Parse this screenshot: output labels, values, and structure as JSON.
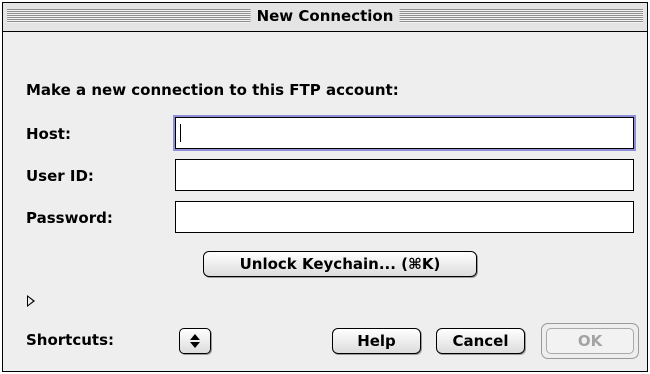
{
  "window": {
    "title": "New Connection"
  },
  "prompt": "Make a new connection to this FTP account:",
  "fields": {
    "host": {
      "label": "Host:",
      "value": ""
    },
    "user": {
      "label": "User ID:",
      "value": ""
    },
    "password": {
      "label": "Password:",
      "value": ""
    }
  },
  "unlock_button": "Unlock Keychain... (⌘K)",
  "shortcuts": {
    "label": "Shortcuts:"
  },
  "buttons": {
    "help": "Help",
    "cancel": "Cancel",
    "ok": "OK"
  },
  "colors": {
    "focus_ring": "#8e8fd6",
    "disabled_text": "#a3a3a3"
  }
}
